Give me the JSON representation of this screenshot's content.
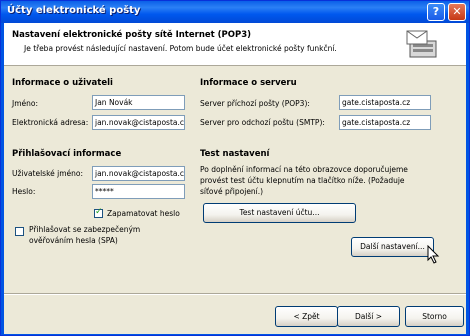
{
  "window": {
    "title": "Účty elektronické pošty"
  },
  "titlebar": {
    "help_glyph": "?",
    "close_glyph": "✕"
  },
  "header": {
    "title": "Nastavení elektronické pošty sítě Internet (POP3)",
    "subtitle": "Je třeba provést následující nastavení. Potom bude účet elektronické pošty funkční.",
    "icon": "mail-server-icon"
  },
  "user_info": {
    "heading": "Informace o uživateli",
    "name_label": "Jméno:",
    "name_value": "Jan Novák",
    "email_label": "Elektronická adresa:",
    "email_value": "jan.novak@cistaposta.cz"
  },
  "server_info": {
    "heading": "Informace o serveru",
    "incoming_label": "Server příchozí pošty (POP3):",
    "incoming_value": "gate.cistaposta.cz",
    "outgoing_label": "Server pro odchozí poštu (SMTP):",
    "outgoing_value": "gate.cistaposta.cz"
  },
  "login_info": {
    "heading": "Přihlašovací informace",
    "username_label": "Uživatelské jméno:",
    "username_value": "jan.novak@cistaposta.cz",
    "password_label": "Heslo:",
    "password_value": "*****",
    "remember_label": "Zapamatovat heslo",
    "remember_checked": true,
    "spa_label_line1": "Přihlašovat se zabezpečeným",
    "spa_label_line2": "ověřováním hesla (SPA)",
    "spa_checked": false
  },
  "test_settings": {
    "heading": "Test nastavení",
    "description_line1": "Po doplnění informací na této obrazovce doporučujeme",
    "description_line2": "provést test účtu klepnutím na tlačítko níže. (Požaduje",
    "description_line3": "síťové připojení.)",
    "test_button": "Test nastavení účtu...",
    "more_button": "Další nastavení..."
  },
  "footer": {
    "back_button": "< Zpět",
    "next_button": "Další >",
    "cancel_button": "Storno"
  },
  "colors": {
    "titlebar": "#0054e3",
    "dialog_bg": "#ece9d8",
    "field_border": "#7f9db9",
    "button_border": "#003c74"
  }
}
